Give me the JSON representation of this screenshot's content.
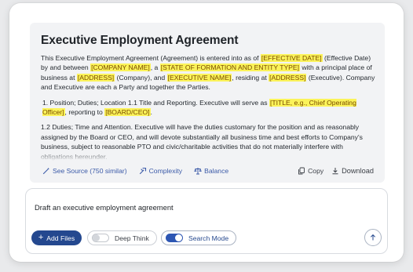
{
  "document": {
    "title": "Executive Employment Agreement",
    "p1": [
      {
        "t": "This Executive Employment Agreement (Agreement) is entered into as of "
      },
      {
        "t": "[EFFECTIVE DATE]",
        "hl": true
      },
      {
        "t": " (Effective Date) by and between "
      },
      {
        "t": "[COMPANY NAME]",
        "hl": true
      },
      {
        "t": ", a "
      },
      {
        "t": "[STATE OF FORMATION AND ENTITY TYPE]",
        "hl": true
      },
      {
        "t": " with a principal place of business at "
      },
      {
        "t": "[ADDRESS]",
        "hl": true
      },
      {
        "t": " (Company), and "
      },
      {
        "t": "[EXECUTIVE NAME]",
        "hl": true
      },
      {
        "t": ", residing at "
      },
      {
        "t": "[ADDRESS]",
        "hl": true
      },
      {
        "t": " (Executive). Company and Executive are each a Party and together the Parties."
      }
    ],
    "p2": [
      {
        "t": "1. Position; Duties; Location 1.1 Title and Reporting. Executive will serve as "
      },
      {
        "t": "[TITLE, e.g., Chief Operating Officer]",
        "hl": true
      },
      {
        "t": ", reporting to "
      },
      {
        "t": "[BOARD/CEO]",
        "hl": true
      },
      {
        "t": "."
      }
    ],
    "p3": "1.2 Duties; Time and Attention. Executive will have the duties customary for the position and as reasonably assigned by the Board or CEO, and will devote substantially all business time and best efforts to Company's business, subject to reasonable PTO and civic/charitable activities that do not materially interfere with obligations hereunder.",
    "actions": {
      "see_source": "See Source (750 similar)",
      "complexity": "Complexity",
      "balance": "Balance",
      "copy": "Copy",
      "download": "Download"
    }
  },
  "input": {
    "prompt": "Draft an executive employment agreement",
    "add_files": "Add Files",
    "deep_think": "Deep Think",
    "deep_think_on": false,
    "search_mode": "Search Mode",
    "search_mode_on": true
  },
  "colors": {
    "highlight": "#fbf35a",
    "accent": "#24488f",
    "link": "#3b5aa8"
  },
  "icons": [
    "wand-icon",
    "complexity-icon",
    "balance-icon",
    "copy-icon",
    "download-icon",
    "plus-icon",
    "arrow-up-icon"
  ]
}
